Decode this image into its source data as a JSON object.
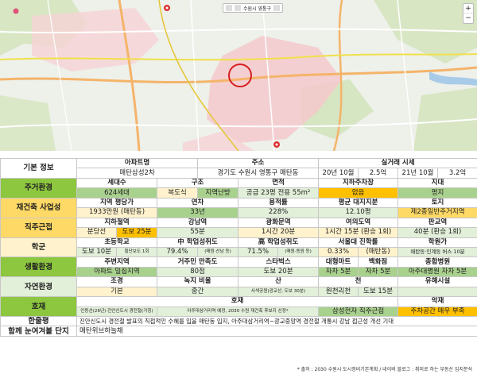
{
  "map": {
    "toolbar_label": "수원시 영통구",
    "zoom_in": "+",
    "zoom_out": "−"
  },
  "table": {
    "basic": {
      "category": "기본 정보",
      "apt_header": "아파트명",
      "apt_value": "매탄삼성2차",
      "addr_header": "주소",
      "addr_value": "경기도 수원시 영통구 매탄동",
      "trade_header": "실거래 시세",
      "trade1_date": "20년 10월",
      "trade1_price": "2.5억",
      "trade2_date": "21년 10월",
      "trade2_price": "3.2억"
    },
    "living": {
      "category": "주거환경",
      "headers": [
        "세대수",
        "구조",
        "면적",
        "지하주차장",
        "지대"
      ],
      "households": "624세대",
      "structure": "복도식",
      "heating": "지역난방",
      "area": "공급 23평  전용 55m²",
      "parking": "없음",
      "terrain": "평지"
    },
    "rebuild": {
      "category": "재건축 사업성",
      "headers": [
        "지역 평당가",
        "연차",
        "용적률",
        "평균 대지지분",
        "토지"
      ],
      "values": [
        "1933만원 (매탄동)",
        "33년",
        "228%",
        "12.10평",
        "제2종일반주거지역"
      ]
    },
    "commute": {
      "category": "직주근접",
      "headers": [
        "지하철역",
        "강남역",
        "광화문역",
        "여의도역",
        "판교역"
      ],
      "station": "분당선",
      "walk": "도보 25분",
      "gangnam": "55분",
      "gwanghwamun": "1시간 20분",
      "yeouido": "1시간 15분 (환승 1회)",
      "pangyo": "40분 (환승 1회)"
    },
    "school": {
      "category": "학군",
      "headers": [
        "초등학교",
        "中 학업성취도",
        "高 학업성취도",
        "서울대 진학률",
        "학원가"
      ],
      "elementary": "도보 10분",
      "elementary_note": "횡단보도 1회",
      "middle": "79.4%",
      "middle_note": "(매원·산남 등)",
      "high": "71.5%",
      "high_note": "(매원·동원 등)",
      "snu": "0.33%",
      "snu_note": "(매탄동)",
      "academy": "매탄동·인계동 버스 10분"
    },
    "life": {
      "category": "생활환경",
      "headers": [
        "주변지역",
        "거주민 만족도",
        "스타벅스",
        "대형마트",
        "백화점",
        "종합병원"
      ],
      "area": "아파트 밀집지역",
      "satisfaction": "80점",
      "starbucks": "도보 20분",
      "mart": "자차 5분",
      "dept": "자차 5분",
      "hospital": "아주대병원 자차 5분"
    },
    "nature": {
      "category": "자연환경",
      "headers": [
        "조경",
        "녹지 비율",
        "산",
        "천",
        "유해시설"
      ],
      "landscape": "기본",
      "green": "중간",
      "mountain": "사색공원(광교산, 도보 30분)",
      "stream": "원천리천",
      "stream_walk": "도보 15분",
      "hazard": ""
    },
    "benefit": {
      "category": "호재",
      "header": "호재",
      "neg_header": "악재",
      "items": [
        "인동선(26년)·진안신도시 경전철(가칭)",
        "아주대삼거리역 예정, 2030 수원 재건축 후보지 선정*",
        "삼성전자 직주근접"
      ],
      "negative": "주차공간 매우 부족"
    },
    "review": {
      "category": "한줄평",
      "text": "진안신도시 경전철 발표의 직접적인 수혜를 입을 매탄동 입지, 아주대삼거리역~광교중앙역 경전철 개통시 강남 접근성 개선 기대"
    },
    "together": {
      "category": "함께 눈여겨볼 단지",
      "text": "매탄위브하늘채"
    }
  },
  "footnote": "* 출처 : 2030 수원시 도시정비기본계획 / 네이버 블로그 : 취미로 하는 부동산 입지분석"
}
